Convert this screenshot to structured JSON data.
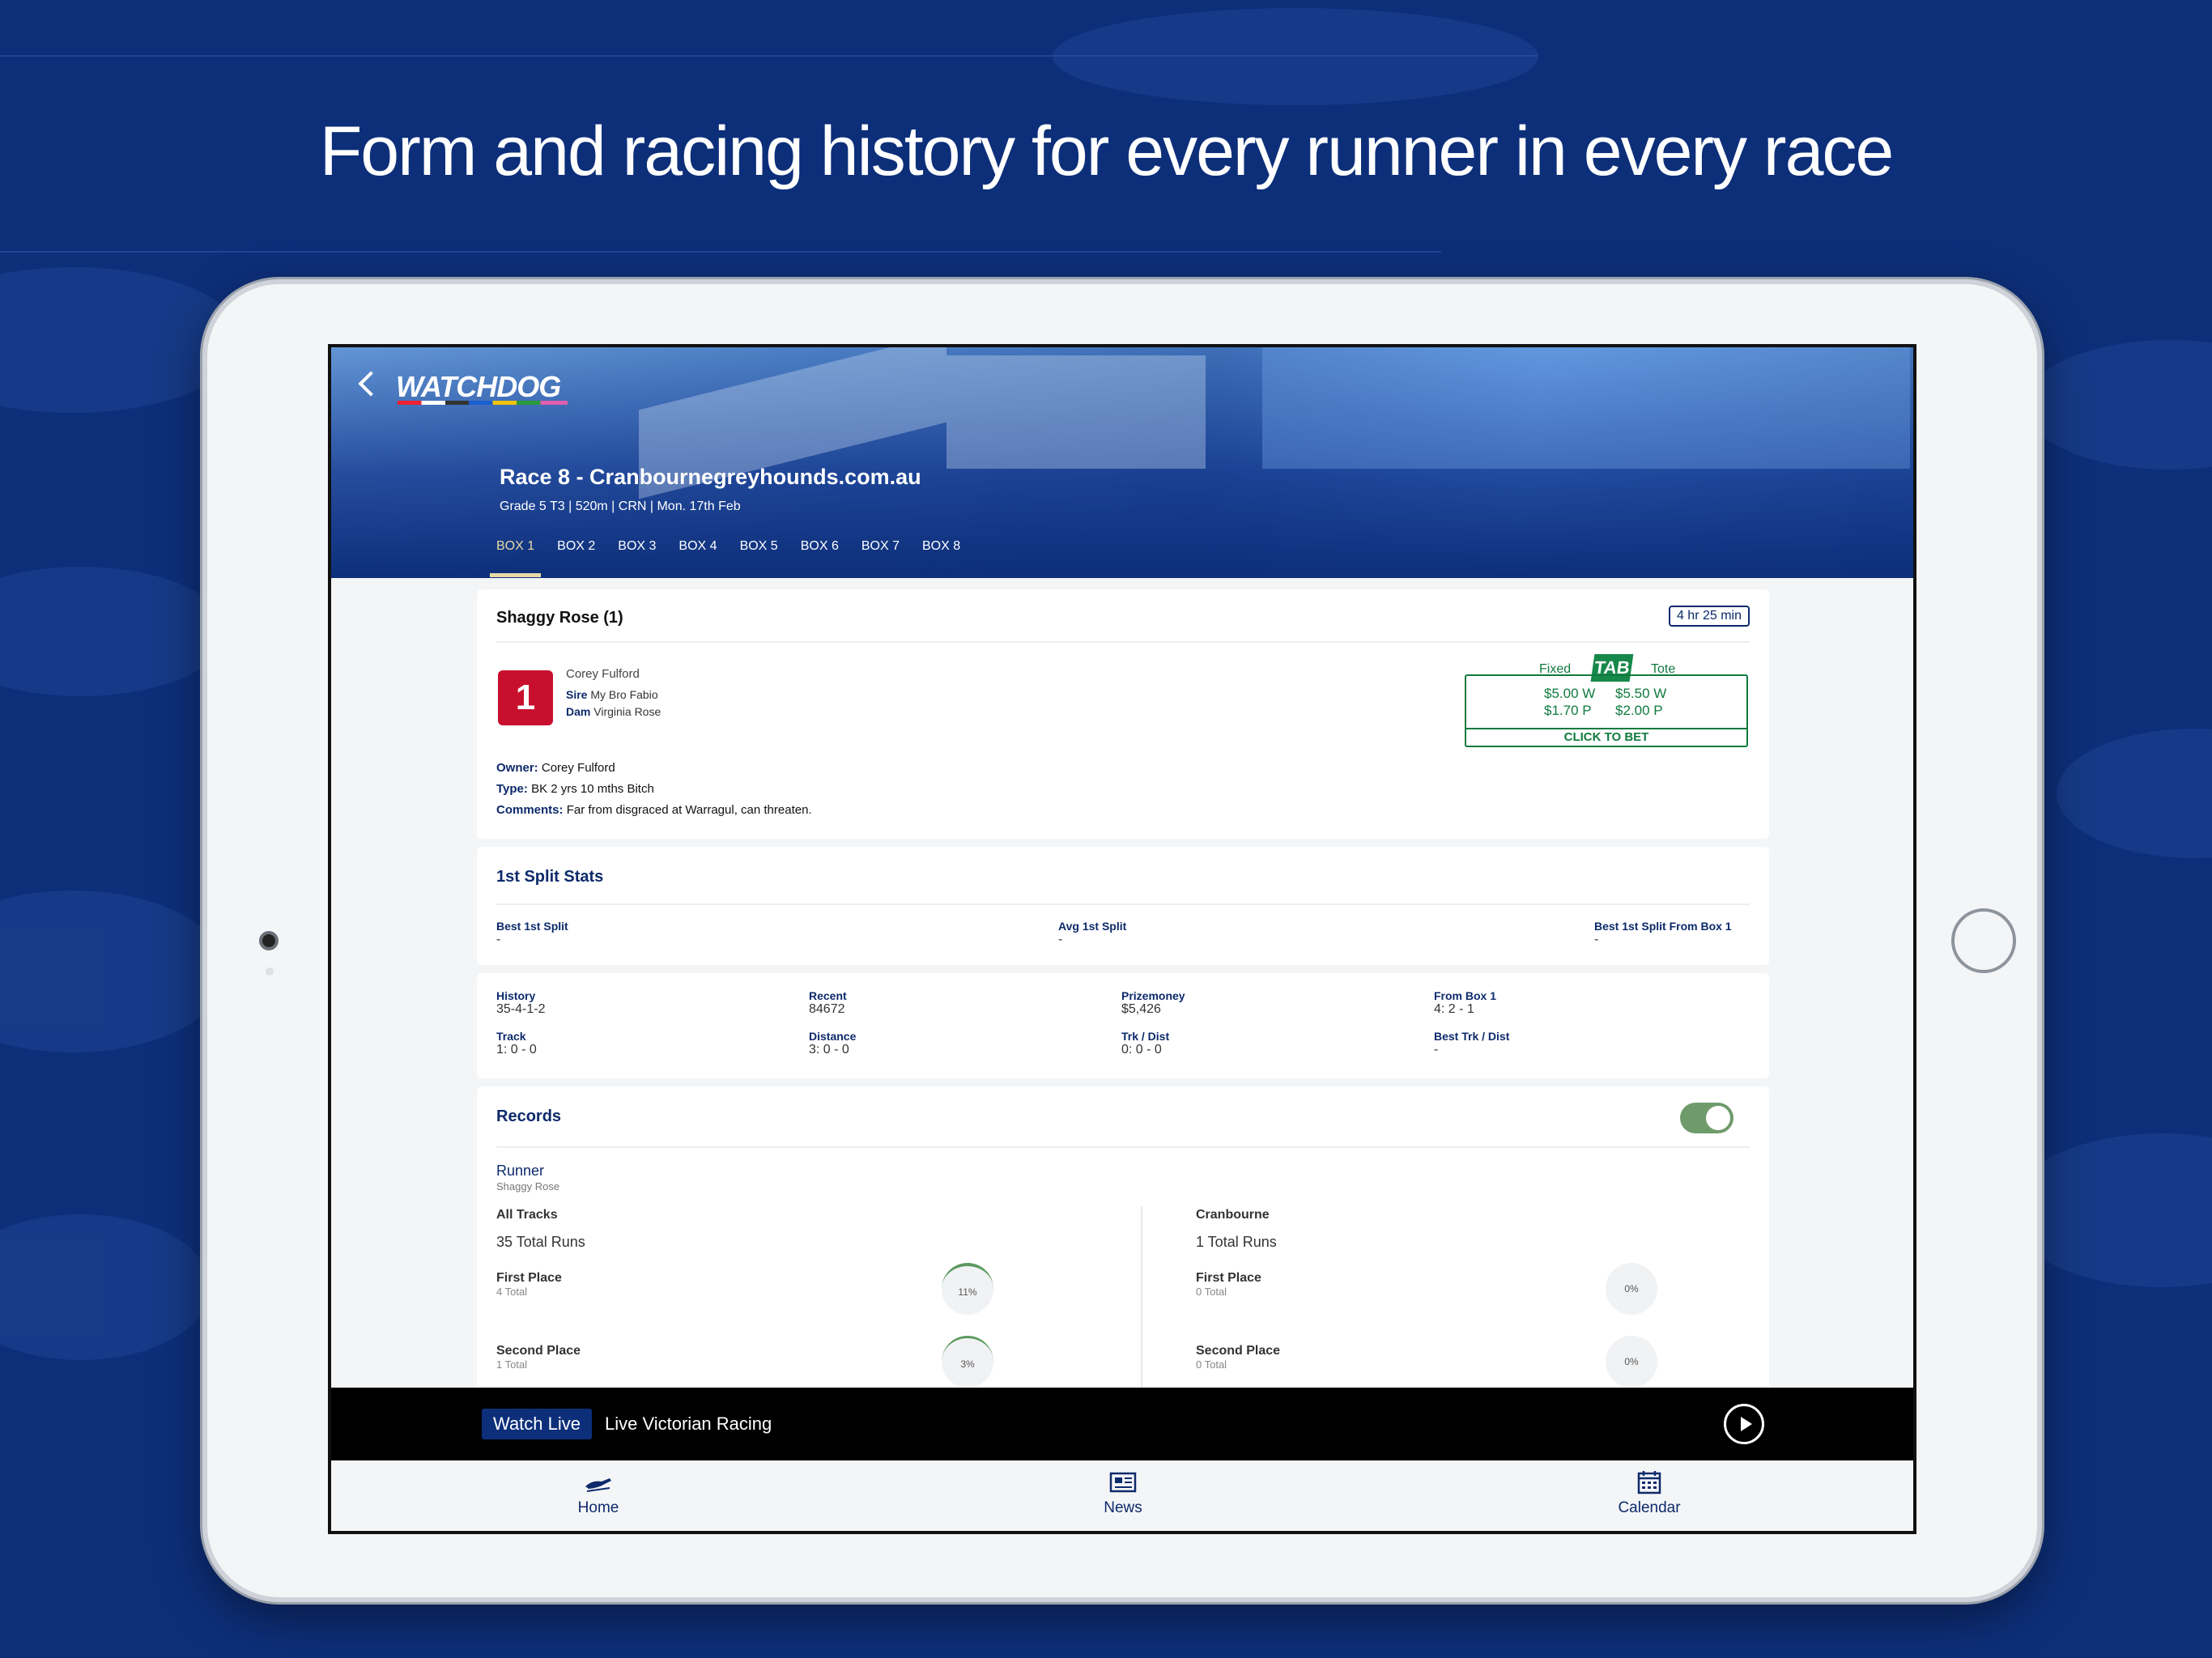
{
  "headline": "Form and racing history for every runner in every race",
  "app": {
    "logo": "WATCHDOG",
    "race_title": "Race 8 - Cranbournegreyhounds.com.au",
    "race_sub": "Grade 5 T3  |  520m  |  CRN  |  Mon. 17th Feb",
    "tabs": [
      "BOX 1",
      "BOX 2",
      "BOX 3",
      "BOX 4",
      "BOX 5",
      "BOX 6",
      "BOX 7",
      "BOX 8"
    ],
    "active_tab": "BOX 1"
  },
  "runner": {
    "name": "Shaggy Rose (1)",
    "countdown": "4 hr 25 min",
    "box": "1",
    "trainer": "Corey Fulford",
    "sire_label": "Sire",
    "sire": "My Bro Fabio",
    "dam_label": "Dam",
    "dam": "Virginia Rose",
    "owner_label": "Owner:",
    "owner": "Corey Fulford",
    "type_label": "Type:",
    "type": "BK 2 yrs 10 mths Bitch",
    "comments_label": "Comments:",
    "comments": "Far from disgraced at Warragul, can threaten."
  },
  "bet": {
    "fixed_label": "Fixed",
    "tote_label": "Tote",
    "tab_logo": "TAB",
    "fixed_win": "$5.00 W",
    "fixed_place": "$1.70 P",
    "tote_win": "$5.50 W",
    "tote_place": "$2.00 P",
    "cta": "CLICK TO BET",
    "color": "#107a3e"
  },
  "split_stats": {
    "title": "1st Split Stats",
    "best_label": "Best 1st Split",
    "best": "-",
    "avg_label": "Avg 1st Split",
    "avg": "-",
    "from_box_label": "Best 1st Split From Box 1",
    "from_box": "-"
  },
  "stats": {
    "history_label": "History",
    "history": "35-4-1-2",
    "recent_label": "Recent",
    "recent": "84672",
    "prize_label": "Prizemoney",
    "prize": "$5,426",
    "frombox_label": "From Box 1",
    "frombox": "4: 2 - 1",
    "track_label": "Track",
    "track": "1: 0 - 0",
    "distance_label": "Distance",
    "distance": "3: 0 - 0",
    "trkdist_label": "Trk / Dist",
    "trkdist": "0: 0 - 0",
    "besttrk_label": "Best Trk / Dist",
    "besttrk": "-"
  },
  "records": {
    "title": "Records",
    "runner_label": "Runner",
    "runner_name": "Shaggy Rose",
    "left": {
      "title": "All Tracks",
      "total": "35 Total Runs",
      "first_label": "First Place",
      "first_total": "4 Total",
      "first_pct": "11%",
      "first_value": 0.11,
      "second_label": "Second Place",
      "second_total": "1 Total",
      "second_pct": "3%",
      "second_value": 0.03
    },
    "right": {
      "title": "Cranbourne",
      "total": "1 Total Runs",
      "first_label": "First Place",
      "first_total": "0 Total",
      "first_pct": "0%",
      "second_label": "Second Place",
      "second_total": "0 Total",
      "second_pct": "0%"
    }
  },
  "watch": {
    "badge": "Watch Live",
    "text": "Live Victorian Racing"
  },
  "nav": {
    "home": "Home",
    "news": "News",
    "calendar": "Calendar"
  }
}
